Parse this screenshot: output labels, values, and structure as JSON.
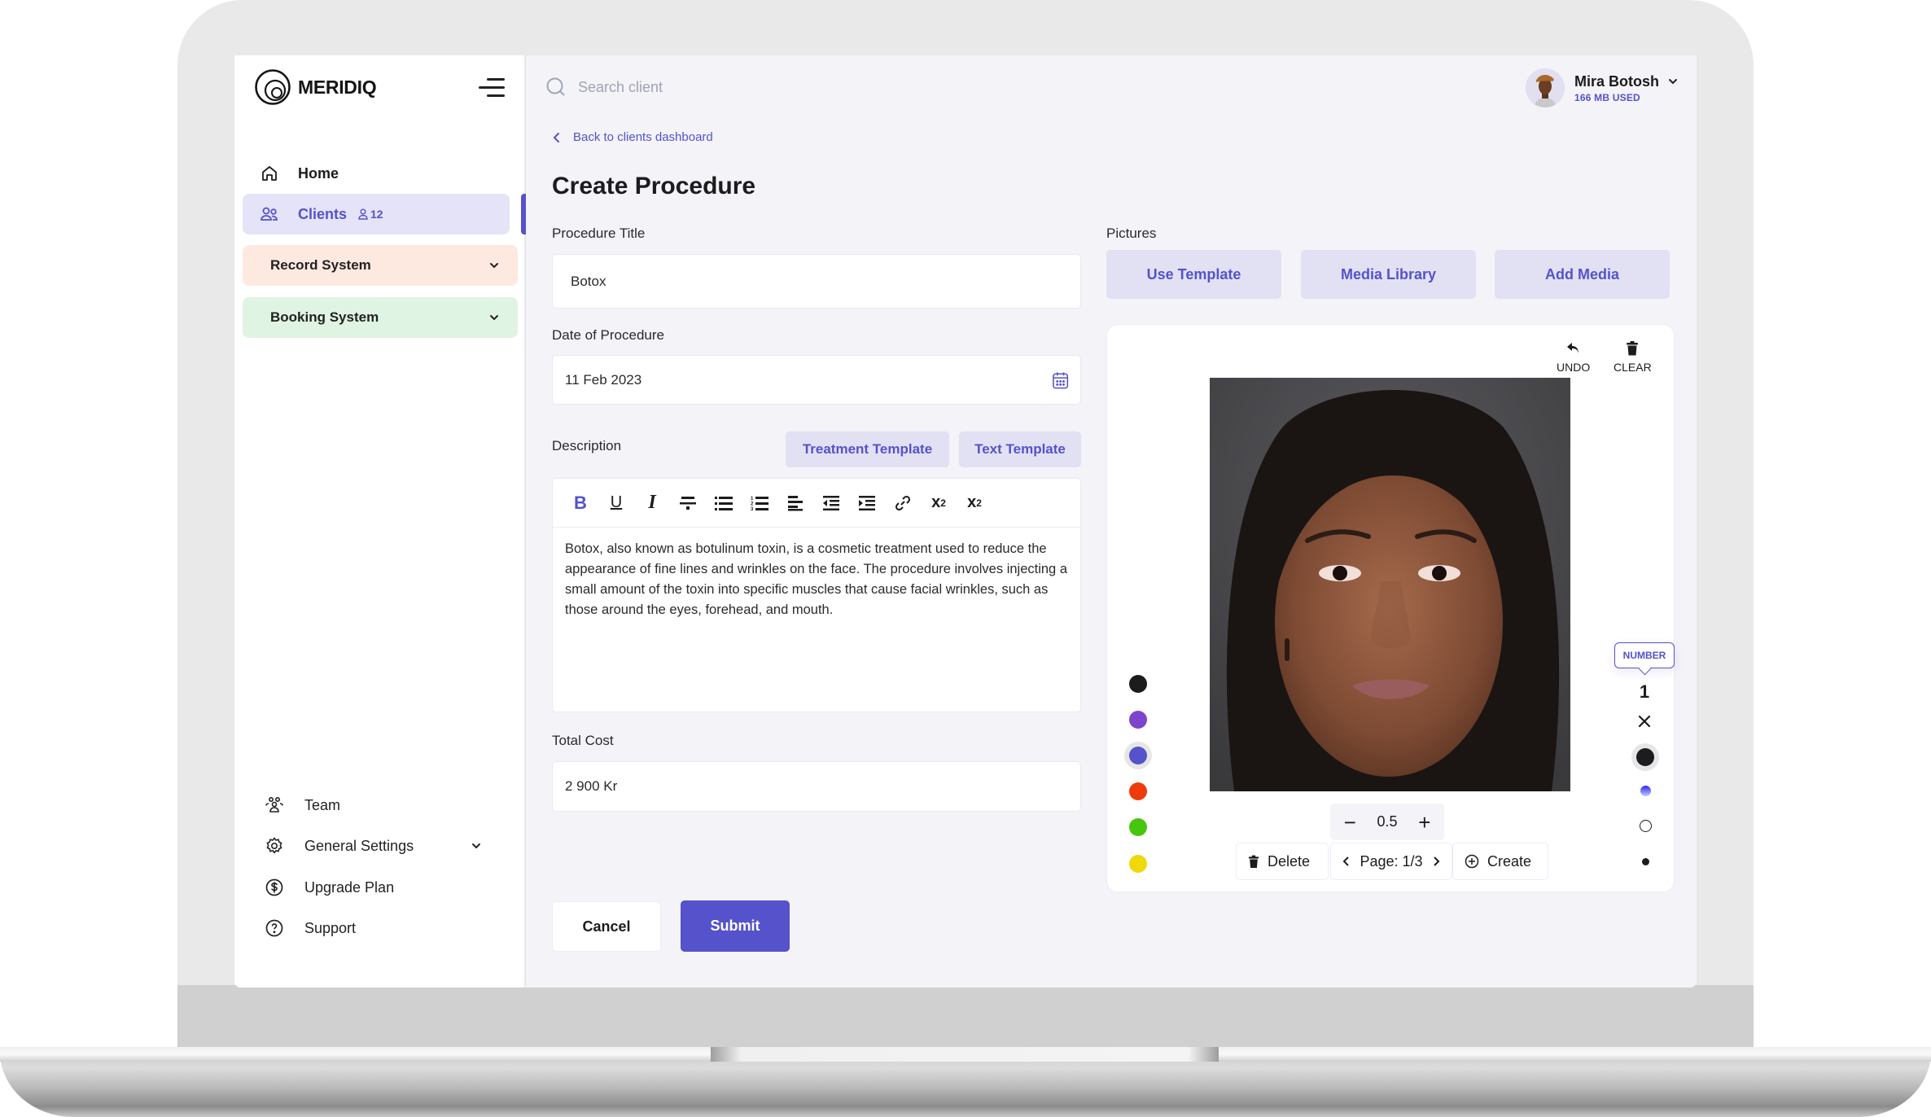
{
  "app": {
    "logo_text": "MERIDIQ"
  },
  "sidebar": {
    "home_label": "Home",
    "clients_label": "Clients",
    "clients_count": "12",
    "groups": [
      {
        "label": "Record System"
      },
      {
        "label": "Booking System"
      }
    ],
    "bottom_items": [
      {
        "label": "Team"
      },
      {
        "label": "General Settings"
      },
      {
        "label": "Upgrade Plan"
      },
      {
        "label": "Support"
      }
    ]
  },
  "topbar": {
    "search_placeholder": "Search client",
    "user_name": "Mira Botosh",
    "user_usage": "166 MB USED"
  },
  "page": {
    "back_link": "Back to clients dashboard",
    "title": "Create Procedure"
  },
  "form": {
    "procedure_title_label": "Procedure Title",
    "procedure_title_value": "Botox",
    "date_label": "Date of Procedure",
    "date_value": "11 Feb 2023",
    "description_label": "Description",
    "treatment_template_label": "Treatment Template",
    "text_template_label": "Text Template",
    "toolbar": [
      "bold",
      "underline",
      "italic",
      "strikethrough",
      "bullet-list",
      "numbered-list",
      "align-left",
      "outdent",
      "indent",
      "link",
      "superscript",
      "subscript"
    ],
    "description_text": "Botox, also known as botulinum toxin, is a cosmetic treatment used to reduce the appearance of fine lines and wrinkles on the face. The procedure involves injecting a small amount of the toxin into specific muscles that cause facial wrinkles, such as those around the eyes, forehead, and mouth.",
    "total_cost_label": "Total Cost",
    "total_cost_value": "2 900 Kr",
    "cancel_label": "Cancel",
    "submit_label": "Submit"
  },
  "pictures": {
    "label": "Pictures",
    "use_template_label": "Use  Template",
    "media_library_label": "Media Library",
    "add_media_label": "Add Media",
    "undo_label": "UNDO",
    "clear_label": "CLEAR",
    "colors": [
      {
        "name": "black",
        "hex": "#1c1c1e"
      },
      {
        "name": "purple",
        "hex": "#7c45cc"
      },
      {
        "name": "indigo",
        "hex": "#5552cc",
        "selected": true
      },
      {
        "name": "red",
        "hex": "#ef3a0d"
      },
      {
        "name": "green",
        "hex": "#46c60e"
      },
      {
        "name": "yellow",
        "hex": "#f0d80a"
      }
    ],
    "tooltip_label": "NUMBER",
    "number_tool_value": "1",
    "zoom_value": "0.5",
    "delete_label": "Delete",
    "page_label": "Page: 1/3",
    "create_label": "Create"
  },
  "colors": {
    "accent": "#5552cc",
    "accent_bg": "#e2e1f3",
    "record_bg": "#fde9df",
    "booking_bg": "#e0f4e3"
  }
}
